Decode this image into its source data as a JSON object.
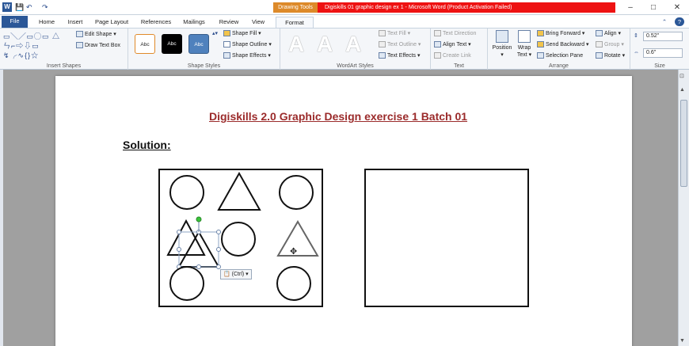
{
  "window": {
    "title_prefix": "Drawing Tools",
    "doc_title": "Digiskills 01 graphic design ex 1 - Microsoft Word (Product Activation Failed)",
    "app_glyph": "W",
    "controls": [
      "–",
      "□",
      "✕"
    ]
  },
  "quick_access": [
    "💾",
    "↶",
    "↷"
  ],
  "tabs": [
    "File",
    "Home",
    "Insert",
    "Page Layout",
    "References",
    "Mailings",
    "Review",
    "View",
    "Format"
  ],
  "ribbon": {
    "insert_shapes": {
      "label": "Insert Shapes",
      "edit_shape": "Edit Shape",
      "draw_text_box": "Draw Text Box",
      "shapes_glyphs": "▭╲╱▭◯▭ △ㄣ⌐⇨⇩▭ ↯╭∿{}☆"
    },
    "shape_styles": {
      "label": "Shape Styles",
      "style_boxes": [
        "Abc",
        "Abc",
        "Abc"
      ],
      "fill": "Shape Fill",
      "outline": "Shape Outline",
      "effects": "Shape Effects"
    },
    "wordart": {
      "label": "WordArt Styles",
      "letters": [
        "A",
        "A",
        "A"
      ],
      "text_fill": "Text Fill",
      "text_outline": "Text Outline",
      "text_effects": "Text Effects"
    },
    "text": {
      "label": "Text",
      "direction": "Text Direction",
      "align": "Align Text",
      "link": "Create Link"
    },
    "arrange": {
      "label": "Arrange",
      "position": "Position",
      "wrap": "Wrap Text",
      "bring_forward": "Bring Forward",
      "send_backward": "Send Backward",
      "selection_pane": "Selection Pane",
      "align": "Align",
      "group": "Group",
      "rotate": "Rotate"
    },
    "size": {
      "label": "Size",
      "height": "0.52\"",
      "width": "0.6\""
    }
  },
  "document": {
    "heading": "Digiskills  2.0 Graphic Design  exercise 1 Batch 01",
    "solution": "Solution:",
    "paste_options": "(Ctrl)"
  },
  "colors": {
    "title_red": "#ee1212",
    "drawing_tools_orange": "#dd8a2a",
    "file_tab_blue": "#2b5797",
    "heading_red": "#9b2b2b"
  }
}
